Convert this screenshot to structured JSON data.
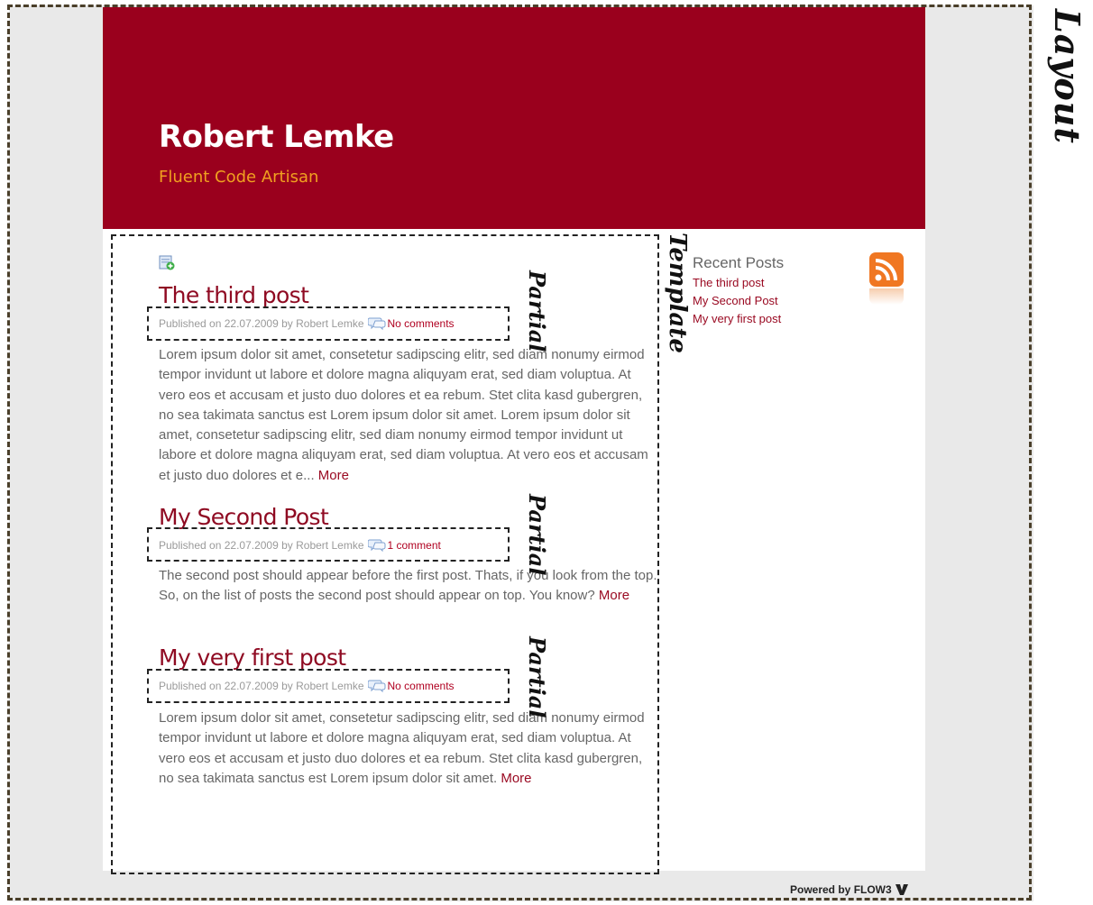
{
  "labels": {
    "layout": "Layout",
    "template": "Template",
    "partial": "Partial"
  },
  "header": {
    "title": "Robert Lemke",
    "subtitle": "Fluent Code Artisan"
  },
  "posts": [
    {
      "title": "The third post",
      "meta_prefix": "Published on 22.07.2009 by Robert Lemke",
      "comments": "No comments",
      "body": "Lorem ipsum dolor sit amet, consetetur sadipscing elitr, sed diam nonumy eirmod tempor invidunt ut labore et dolore magna aliquyam erat, sed diam voluptua. At vero eos et accusam et justo duo dolores et ea rebum. Stet clita kasd gubergren, no sea takimata sanctus est Lorem ipsum dolor sit amet. Lorem ipsum dolor sit amet, consetetur sadipscing elitr, sed diam nonumy eirmod tempor invidunt ut labore et dolore magna aliquyam erat, sed diam voluptua. At vero eos et accusam et justo duo dolores et e...",
      "more": "More"
    },
    {
      "title": "My Second Post",
      "meta_prefix": "Published on 22.07.2009 by Robert Lemke",
      "comments": "1 comment",
      "body": "The second post should appear before the first post. Thats, if you look from the top. So, on the list of posts the second post should appear on top. You know?",
      "more": "More"
    },
    {
      "title": "My very first post",
      "meta_prefix": "Published on 22.07.2009 by Robert Lemke",
      "comments": "No comments",
      "body": "Lorem ipsum dolor sit amet, consetetur sadipscing elitr, sed diam nonumy eirmod tempor invidunt ut labore et dolore magna aliquyam erat, sed diam voluptua. At vero eos et accusam et justo duo dolores et ea rebum. Stet clita kasd gubergren, no sea takimata sanctus est Lorem ipsum dolor sit amet.",
      "more": "More"
    }
  ],
  "sidebar": {
    "title": "Recent Posts",
    "items": [
      "The third post",
      "My Second Post",
      "My very first post"
    ]
  },
  "footer": {
    "powered_by": "Powered by FLOW3"
  },
  "colors": {
    "header_bg": "#9a001d",
    "accent": "#9a0a22",
    "subtitle": "#f0a020",
    "rss": "#f07722"
  },
  "icons": [
    "new-post-icon",
    "comment-bubble-icon",
    "rss-icon",
    "flow3-logo-icon"
  ]
}
